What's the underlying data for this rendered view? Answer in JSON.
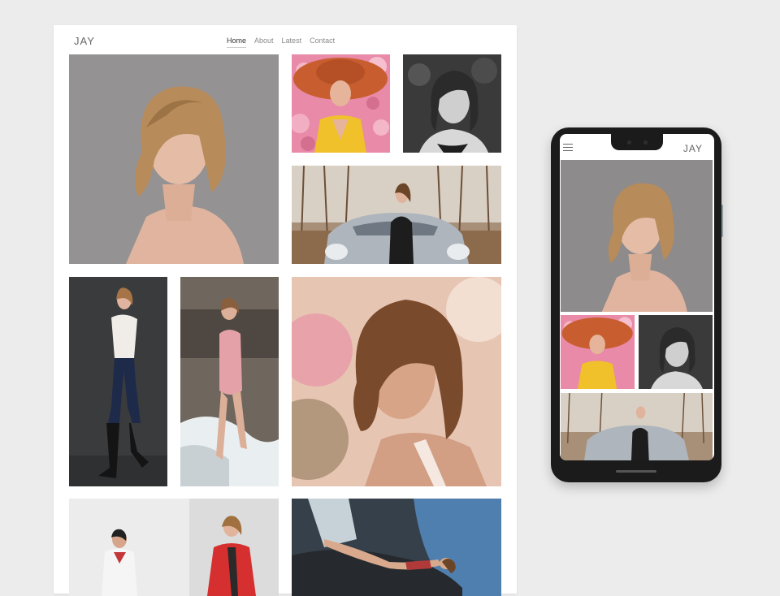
{
  "desktop": {
    "logo": "JAY",
    "nav": [
      {
        "label": "Home",
        "active": true
      },
      {
        "label": "About",
        "active": false
      },
      {
        "label": "Latest",
        "active": false
      },
      {
        "label": "Contact",
        "active": false
      }
    ]
  },
  "phone": {
    "logo": "JAY",
    "menu_icon": "hamburger-menu-icon"
  },
  "colors": {
    "background": "#ececec",
    "card": "#ffffff",
    "phone_body": "#1b1b1b",
    "nav_text": "#8a8a8a",
    "nav_active": "#333333"
  }
}
